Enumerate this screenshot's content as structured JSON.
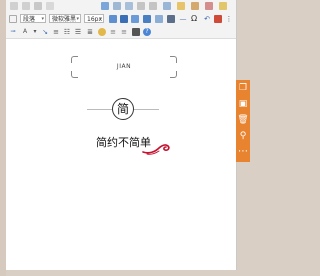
{
  "toolbar": {
    "paragraph_select": "段落",
    "font_select": "微软雅黑",
    "size_select": "16px"
  },
  "content": {
    "heading_latin": "JIAN",
    "circle_char": "简",
    "subtitle": "简约不简单"
  },
  "sidebar": {
    "items": [
      {
        "icon": "copy-icon"
      },
      {
        "icon": "save-icon"
      },
      {
        "icon": "trash-icon"
      },
      {
        "icon": "search-icon"
      },
      {
        "icon": "more-icon"
      }
    ]
  },
  "colors": {
    "accent": "#e8832f",
    "swirl": "#c4122f",
    "background": "#d9cfc4"
  }
}
